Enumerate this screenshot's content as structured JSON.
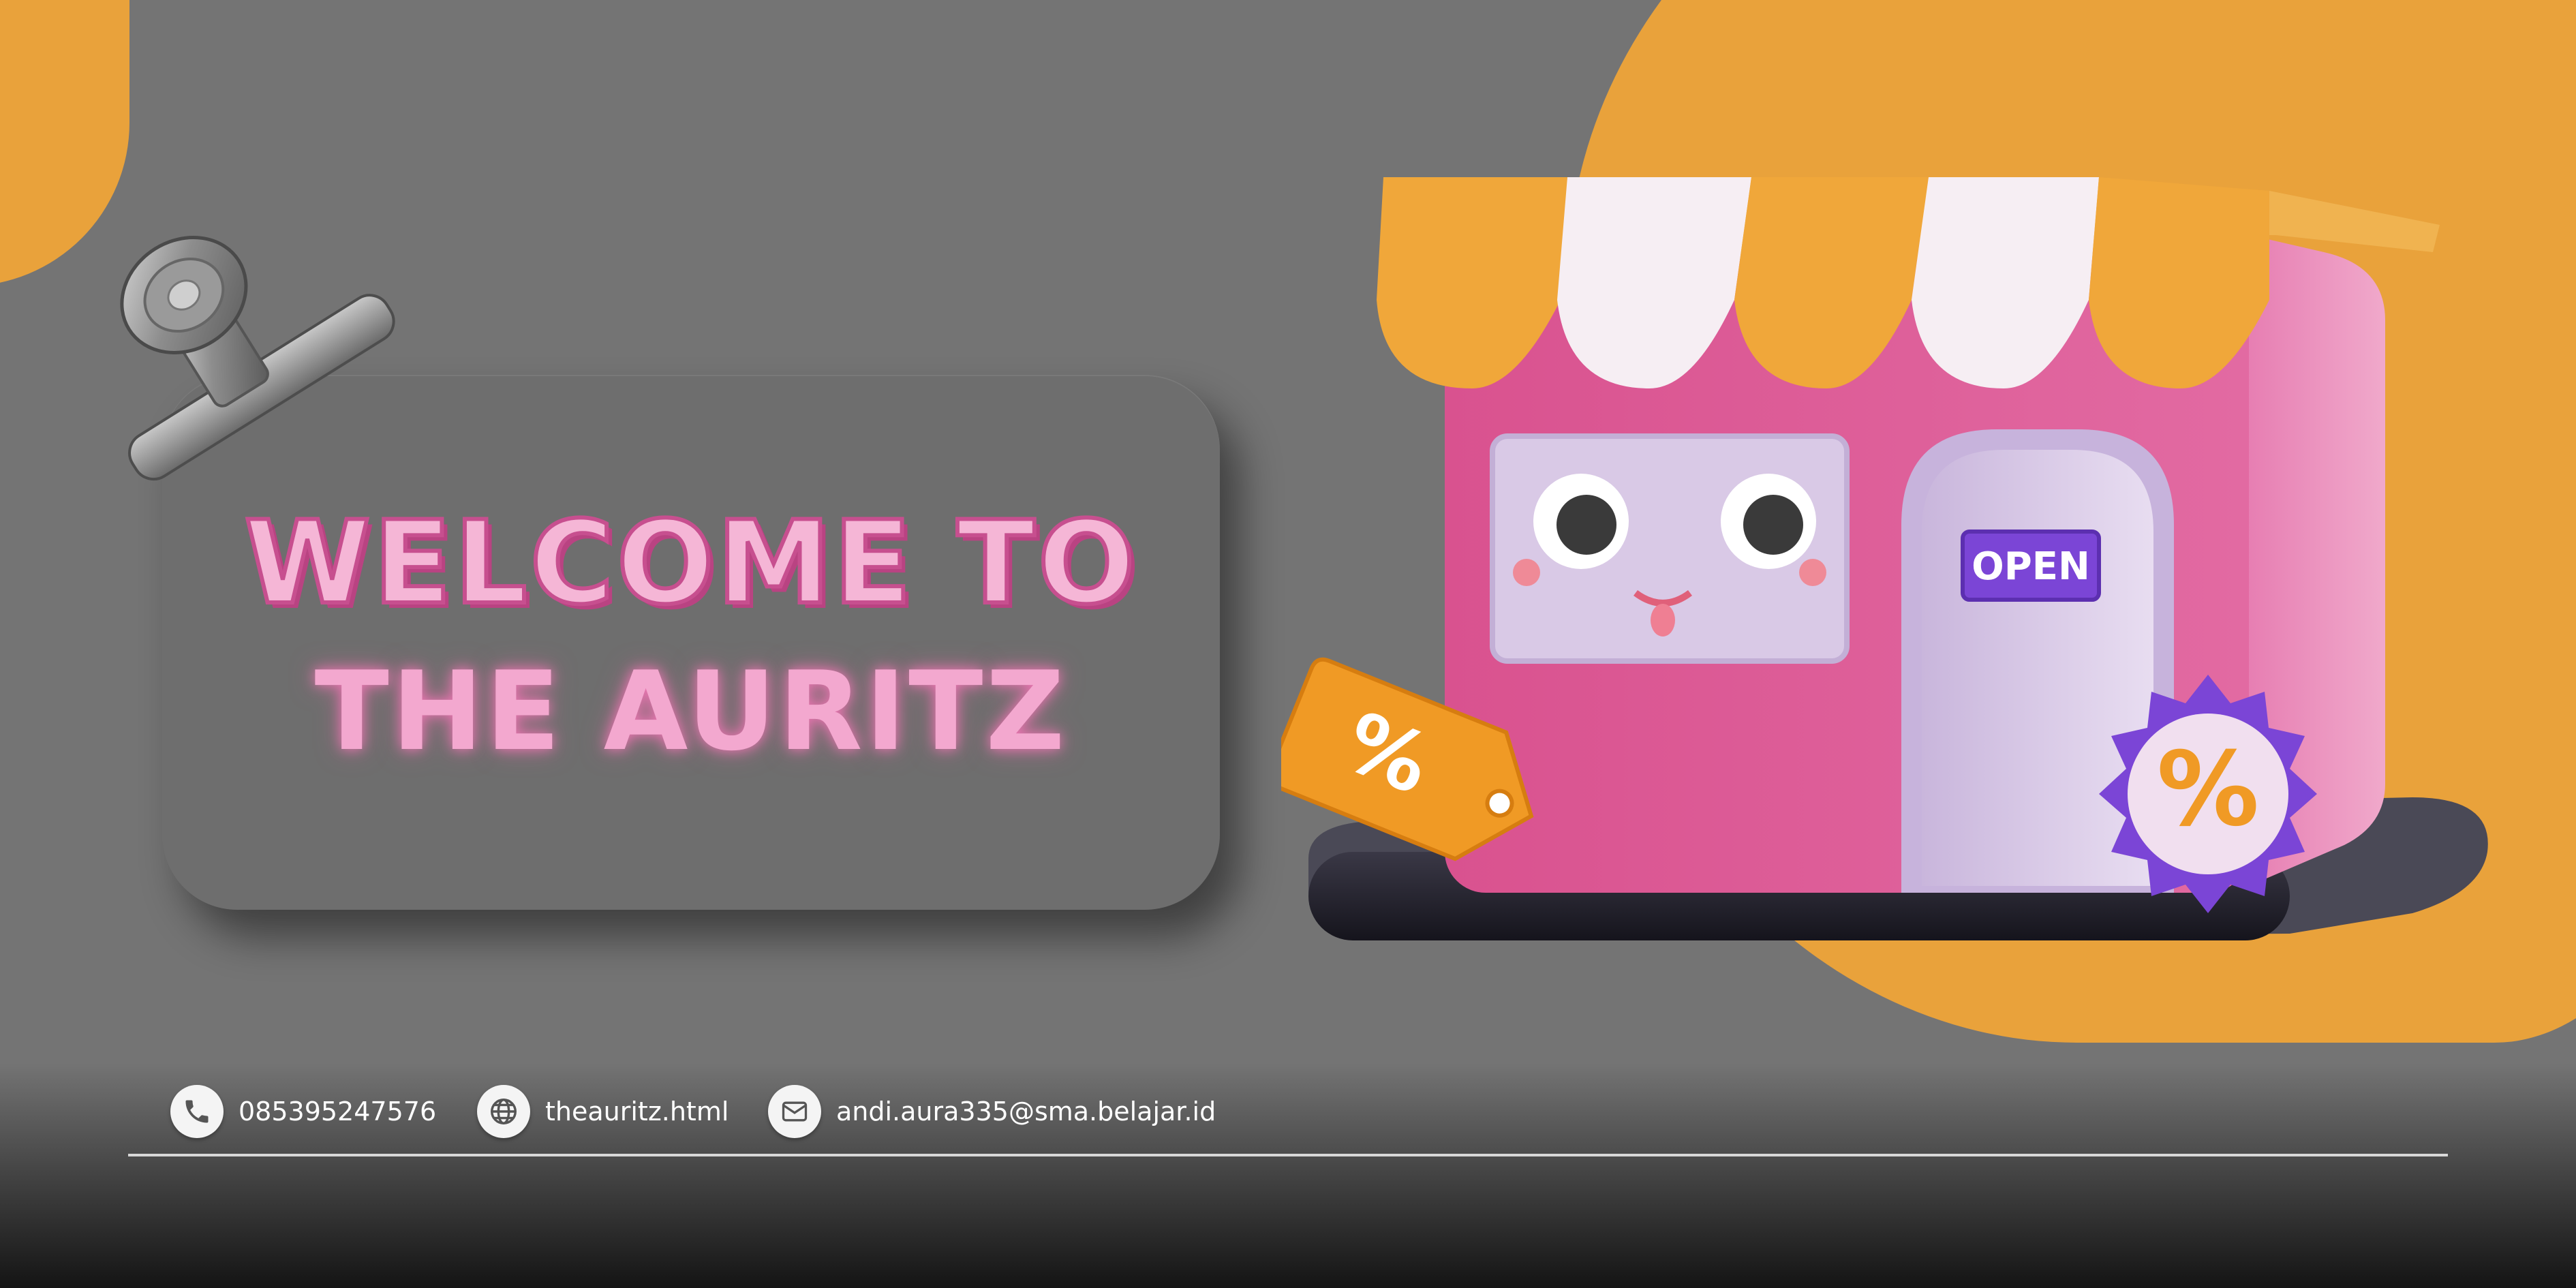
{
  "banner": {
    "welcome_line_1": "WELCOME TO",
    "welcome_line_2": "THE AURITZ"
  },
  "shop": {
    "door_sign": "OPEN",
    "tag_symbol": "%",
    "badge_symbol": "%"
  },
  "contacts": [
    {
      "icon": "phone-icon",
      "text": "085395247576"
    },
    {
      "icon": "globe-icon",
      "text": "theauritz.html"
    },
    {
      "icon": "mail-icon",
      "text": "andi.aura335@sma.belajar.id"
    }
  ],
  "colors": {
    "background": "#747474",
    "accent_orange": "#e9a23b",
    "shop_pink": "#d9528f",
    "title_pink": "#f3a8cf",
    "badge_purple": "#7b45d6"
  }
}
